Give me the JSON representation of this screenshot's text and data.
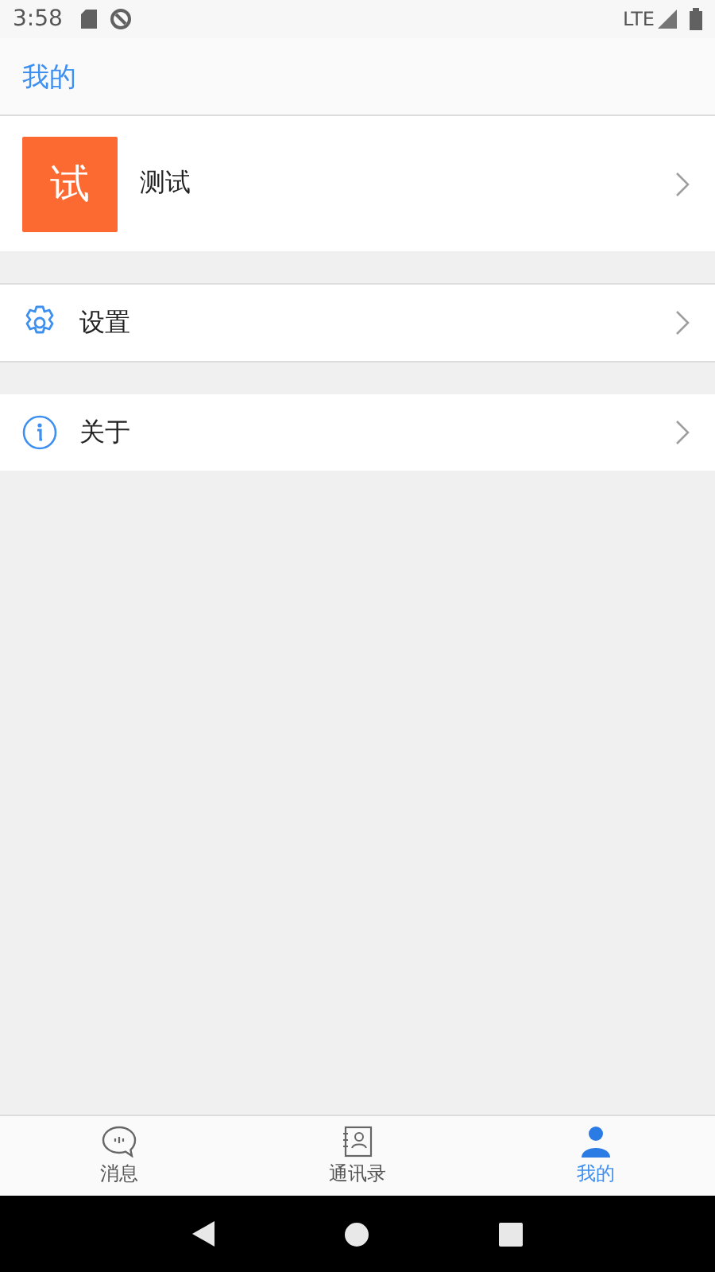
{
  "status_bar": {
    "time": "3:58",
    "network": "LTE"
  },
  "header": {
    "title": "我的"
  },
  "profile": {
    "avatar_text": "试",
    "name": "测试"
  },
  "menu_groups": [
    [
      {
        "kind": "settings",
        "label": "设置"
      }
    ],
    [
      {
        "kind": "about",
        "label": "关于"
      }
    ]
  ],
  "tabs": [
    {
      "kind": "messages",
      "label": "消息",
      "selected": false
    },
    {
      "kind": "contacts",
      "label": "通讯录",
      "selected": false
    },
    {
      "kind": "me",
      "label": "我的",
      "selected": true
    }
  ]
}
